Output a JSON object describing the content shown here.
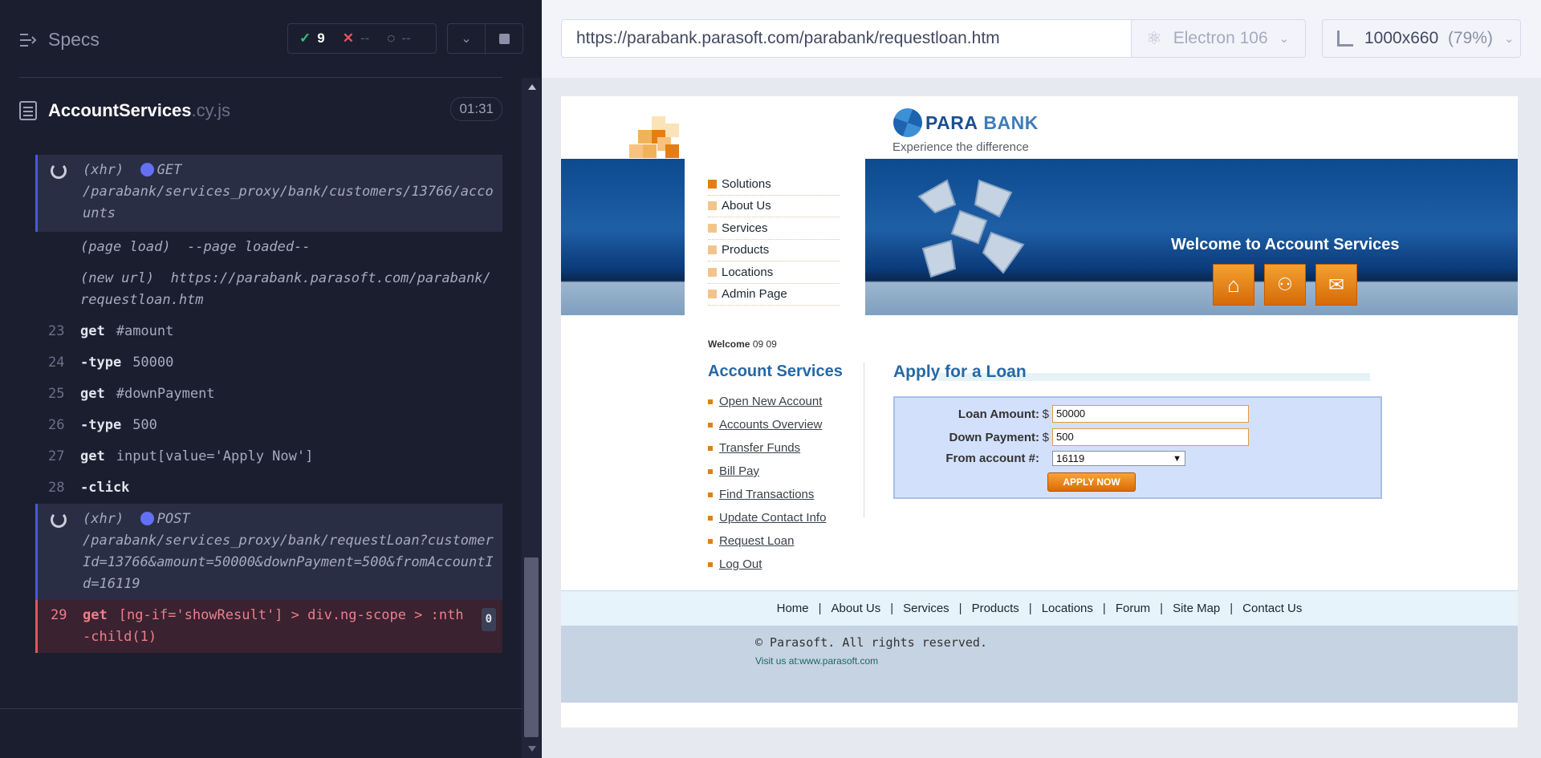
{
  "reporter": {
    "title": "Specs",
    "stats": {
      "passed": "9",
      "failed": "--",
      "pending": "--"
    },
    "spec": {
      "name": "AccountServices",
      "ext": ".cy.js",
      "duration": "01:31"
    },
    "commands": [
      {
        "idx": "",
        "type": "xhr",
        "name": "(xhr)",
        "method": "GET",
        "msg": "/parabank/services_proxy/bank/customers/13766/accounts"
      },
      {
        "idx": "",
        "type": "event",
        "name": "(page load)",
        "msg": "--page loaded--"
      },
      {
        "idx": "",
        "type": "event",
        "name": "(new url)",
        "msg": "https://parabank.parasoft.com/parabank/requestloan.htm"
      },
      {
        "idx": "23",
        "type": "cmd",
        "name": "get",
        "msg": "#amount"
      },
      {
        "idx": "24",
        "type": "cmd",
        "name": "-type",
        "msg": "50000"
      },
      {
        "idx": "25",
        "type": "cmd",
        "name": "get",
        "msg": "#downPayment"
      },
      {
        "idx": "26",
        "type": "cmd",
        "name": "-type",
        "msg": "500"
      },
      {
        "idx": "27",
        "type": "cmd",
        "name": "get",
        "msg": "input[value='Apply Now']"
      },
      {
        "idx": "28",
        "type": "cmd",
        "name": "-click",
        "msg": ""
      },
      {
        "idx": "",
        "type": "xhr",
        "name": "(xhr)",
        "method": "POST",
        "msg": "/parabank/services_proxy/bank/requestLoan?customerId=13766&amount=50000&downPayment=500&fromAccountId=16119"
      },
      {
        "idx": "29",
        "type": "failed",
        "name": "get",
        "msg": "[ng-if='showResult'] > div.ng-scope > :nth-child(1)",
        "badge": "0"
      }
    ]
  },
  "header": {
    "url": "https://parabank.parasoft.com/parabank/requestloan.htm",
    "browser": "Electron 106",
    "viewport": "1000x660",
    "zoom": "(79%)"
  },
  "aut": {
    "logo_text_a": "PARA",
    "logo_text_b": "BANK",
    "tagline": "Experience the difference",
    "nav": [
      "Solutions",
      "About Us",
      "Services",
      "Products",
      "Locations",
      "Admin Page"
    ],
    "banner_title": "Welcome to Account Services",
    "welcome_label": "Welcome",
    "welcome_user": "09 09",
    "services_title": "Account Services",
    "services_links": [
      "Open New Account",
      "Accounts Overview",
      "Transfer Funds",
      "Bill Pay",
      "Find Transactions",
      "Update Contact Info",
      "Request Loan",
      "Log Out"
    ],
    "loan": {
      "title": "Apply for a Loan",
      "amount_label": "Loan Amount:",
      "amount_currency": "$",
      "amount_value": "50000",
      "down_label": "Down Payment:",
      "down_currency": "$",
      "down_value": "500",
      "account_label": "From account #:",
      "account_value": "16119",
      "apply_label": "APPLY NOW"
    },
    "footer_links": [
      "Home",
      "About Us",
      "Services",
      "Products",
      "Locations",
      "Forum",
      "Site Map",
      "Contact Us"
    ],
    "copyright": "© Parasoft. All rights reserved.",
    "visit_label": "Visit us at:",
    "visit_url": "www.parasoft.com"
  },
  "colors": {
    "accent": "#4956e3",
    "pass": "#2ec47d",
    "fail": "#e55361",
    "bank_orange": "#e37f12",
    "bank_blue": "#2668a6"
  }
}
